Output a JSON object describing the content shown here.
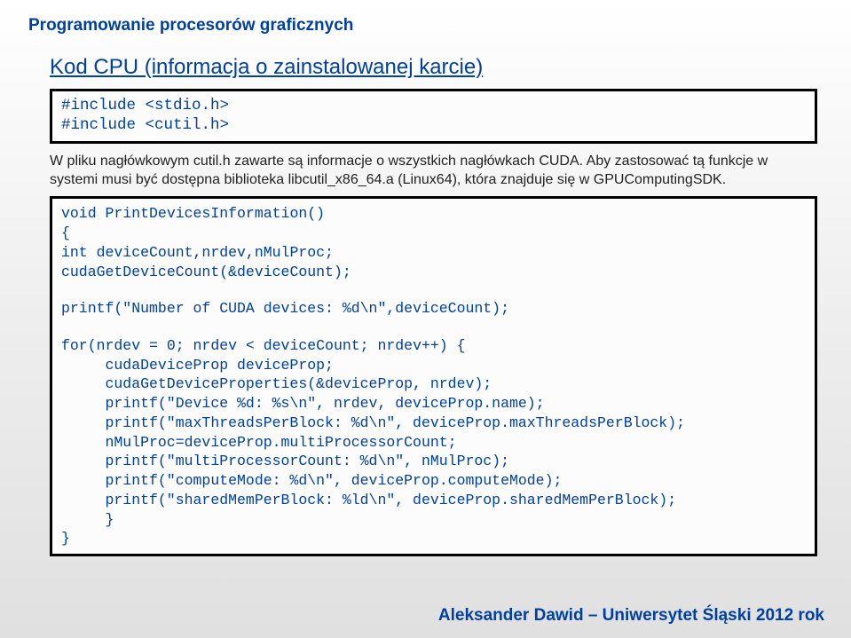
{
  "header": {
    "title": "Programowanie procesorów graficznych"
  },
  "section": {
    "title": "Kod CPU (informacja o zainstalowanej karcie)"
  },
  "codebox1": {
    "l1": "#include <stdio.h>",
    "l2": "#include <cutil.h>"
  },
  "note1": {
    "text": "W pliku nagłówkowym cutil.h zawarte są informacje o wszystkich nagłówkach CUDA. Aby zastosować tą funkcje w systemi musi być dostępna biblioteka libcutil_x86_64.a (Linux64), która znajduje się w GPUComputingSDK."
  },
  "codebox2": {
    "l1": "void PrintDevicesInformation()",
    "l2": "{",
    "l3": "int deviceCount,nrdev,nMulProc;",
    "l4": "cudaGetDeviceCount(&deviceCount);",
    "l5": "printf(\"Number of CUDA devices: %d\\n\",deviceCount);",
    "l6": "for(nrdev = 0; nrdev < deviceCount; nrdev++) {",
    "l7": "cudaDeviceProp deviceProp;",
    "l8": "cudaGetDeviceProperties(&deviceProp, nrdev);",
    "l9": "printf(\"Device %d: %s\\n\", nrdev, deviceProp.name);",
    "l10": "printf(\"maxThreadsPerBlock: %d\\n\", deviceProp.maxThreadsPerBlock);",
    "l11": "nMulProc=deviceProp.multiProcessorCount;",
    "l12": "printf(\"multiProcessorCount: %d\\n\", nMulProc);",
    "l13": "printf(\"computeMode: %d\\n\", deviceProp.computeMode);",
    "l14": "printf(\"sharedMemPerBlock: %ld\\n\", deviceProp.sharedMemPerBlock);",
    "l15": "}",
    "l16": "}"
  },
  "footer": {
    "text": "Aleksander Dawid – Uniwersytet Śląski 2012 rok"
  }
}
